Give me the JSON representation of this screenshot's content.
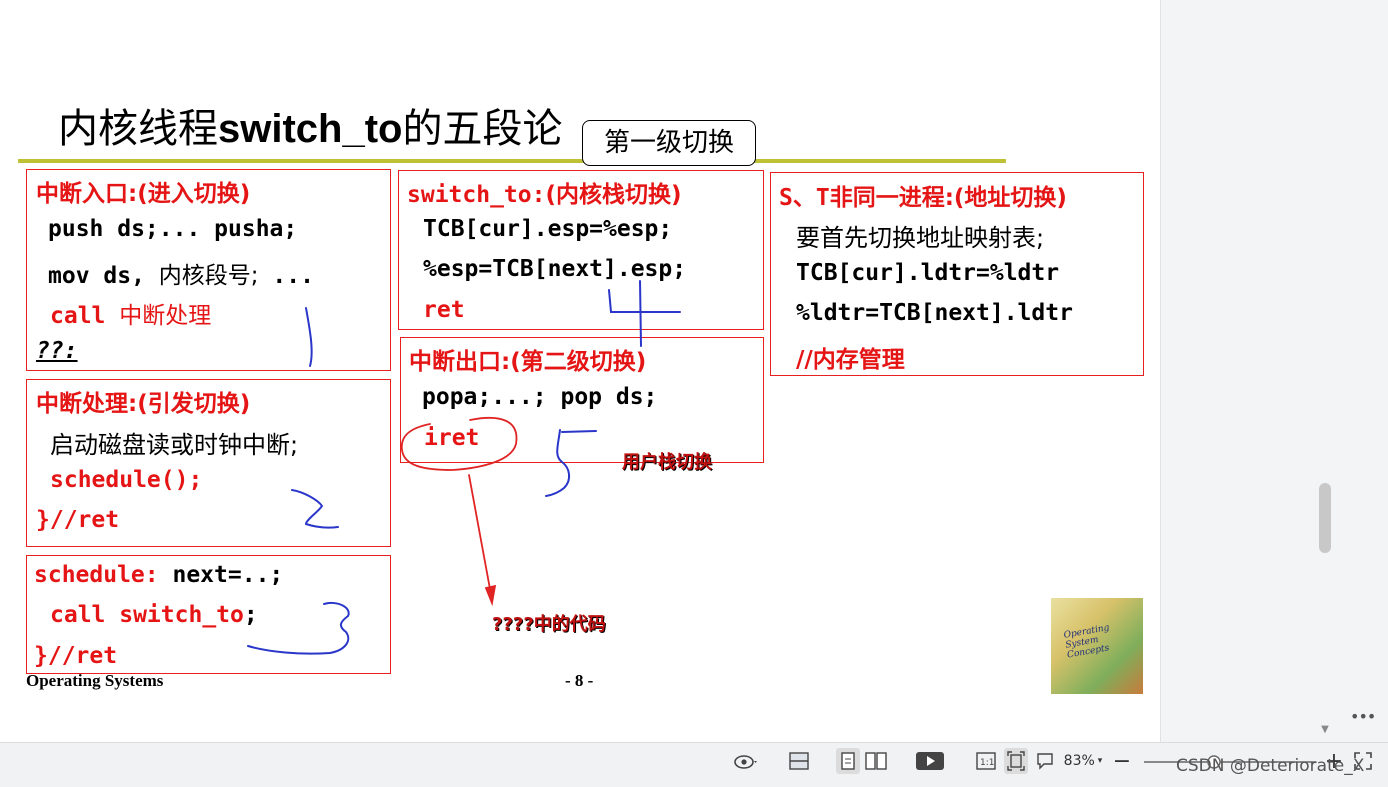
{
  "slide": {
    "title_cn_before": "内核线程",
    "title_code": "switch_to",
    "title_cn_after": "的五段论",
    "callout": "第一级切换",
    "box1": {
      "heading": "中断入口:(进入切换)",
      "l1": "push ds;... pusha;",
      "l2_code": "mov ds,",
      "l2_cn": "内核段号;",
      "l2_tail": "...",
      "l3_code": "call",
      "l3_cn": "中断处理",
      "l4": "??:"
    },
    "box2": {
      "heading": "中断处理:(引发切换)",
      "l1": "启动磁盘读或时钟中断;",
      "l2": "schedule();",
      "l3": "}//ret"
    },
    "box3": {
      "l1_code": "schedule:",
      "l1_tail": "next=..;",
      "l2_code": "call switch_to",
      "l2_tail": ";",
      "l3": "}//ret"
    },
    "box4": {
      "heading_code": "switch_to:",
      "heading_cn": "(内核栈切换)",
      "l1": "TCB[cur].esp=%esp;",
      "l2": "%esp=TCB[next].esp;",
      "l3": "ret"
    },
    "box5": {
      "heading": "中断出口:(第二级切换)",
      "l1": "popa;...; pop ds;",
      "l2": "iret"
    },
    "box6": {
      "heading_code": "S、T",
      "heading_cn": "非同一进程:(地址切换)",
      "l1": "要首先切换地址映射表;",
      "l2": "TCB[cur].ldtr=%ldtr",
      "l3": "%ldtr=TCB[next].ldtr",
      "l4": "//内存管理"
    },
    "note_user_stack": "用户栈切换",
    "note_code": "????中的代码",
    "footer_left": "Operating Systems",
    "footer_page": "- 8 -",
    "book_title": "Operating System Concepts"
  },
  "statusbar": {
    "zoom": "83%",
    "watermark": "CSDN @Deteriorate_X"
  },
  "colors": {
    "accent_red": "#e51515",
    "rule_olive": "#bec035",
    "ink_blue": "#2a36c9",
    "ink_red": "#e02424"
  },
  "icons": [
    "eye-icon",
    "fit-width-icon",
    "single-page-icon",
    "two-page-icon",
    "play-icon",
    "actual-size-icon",
    "fit-page-icon",
    "comment-icon",
    "zoom-out-icon",
    "zoom-slider",
    "zoom-in-icon",
    "fullscreen-icon",
    "more-icon"
  ]
}
